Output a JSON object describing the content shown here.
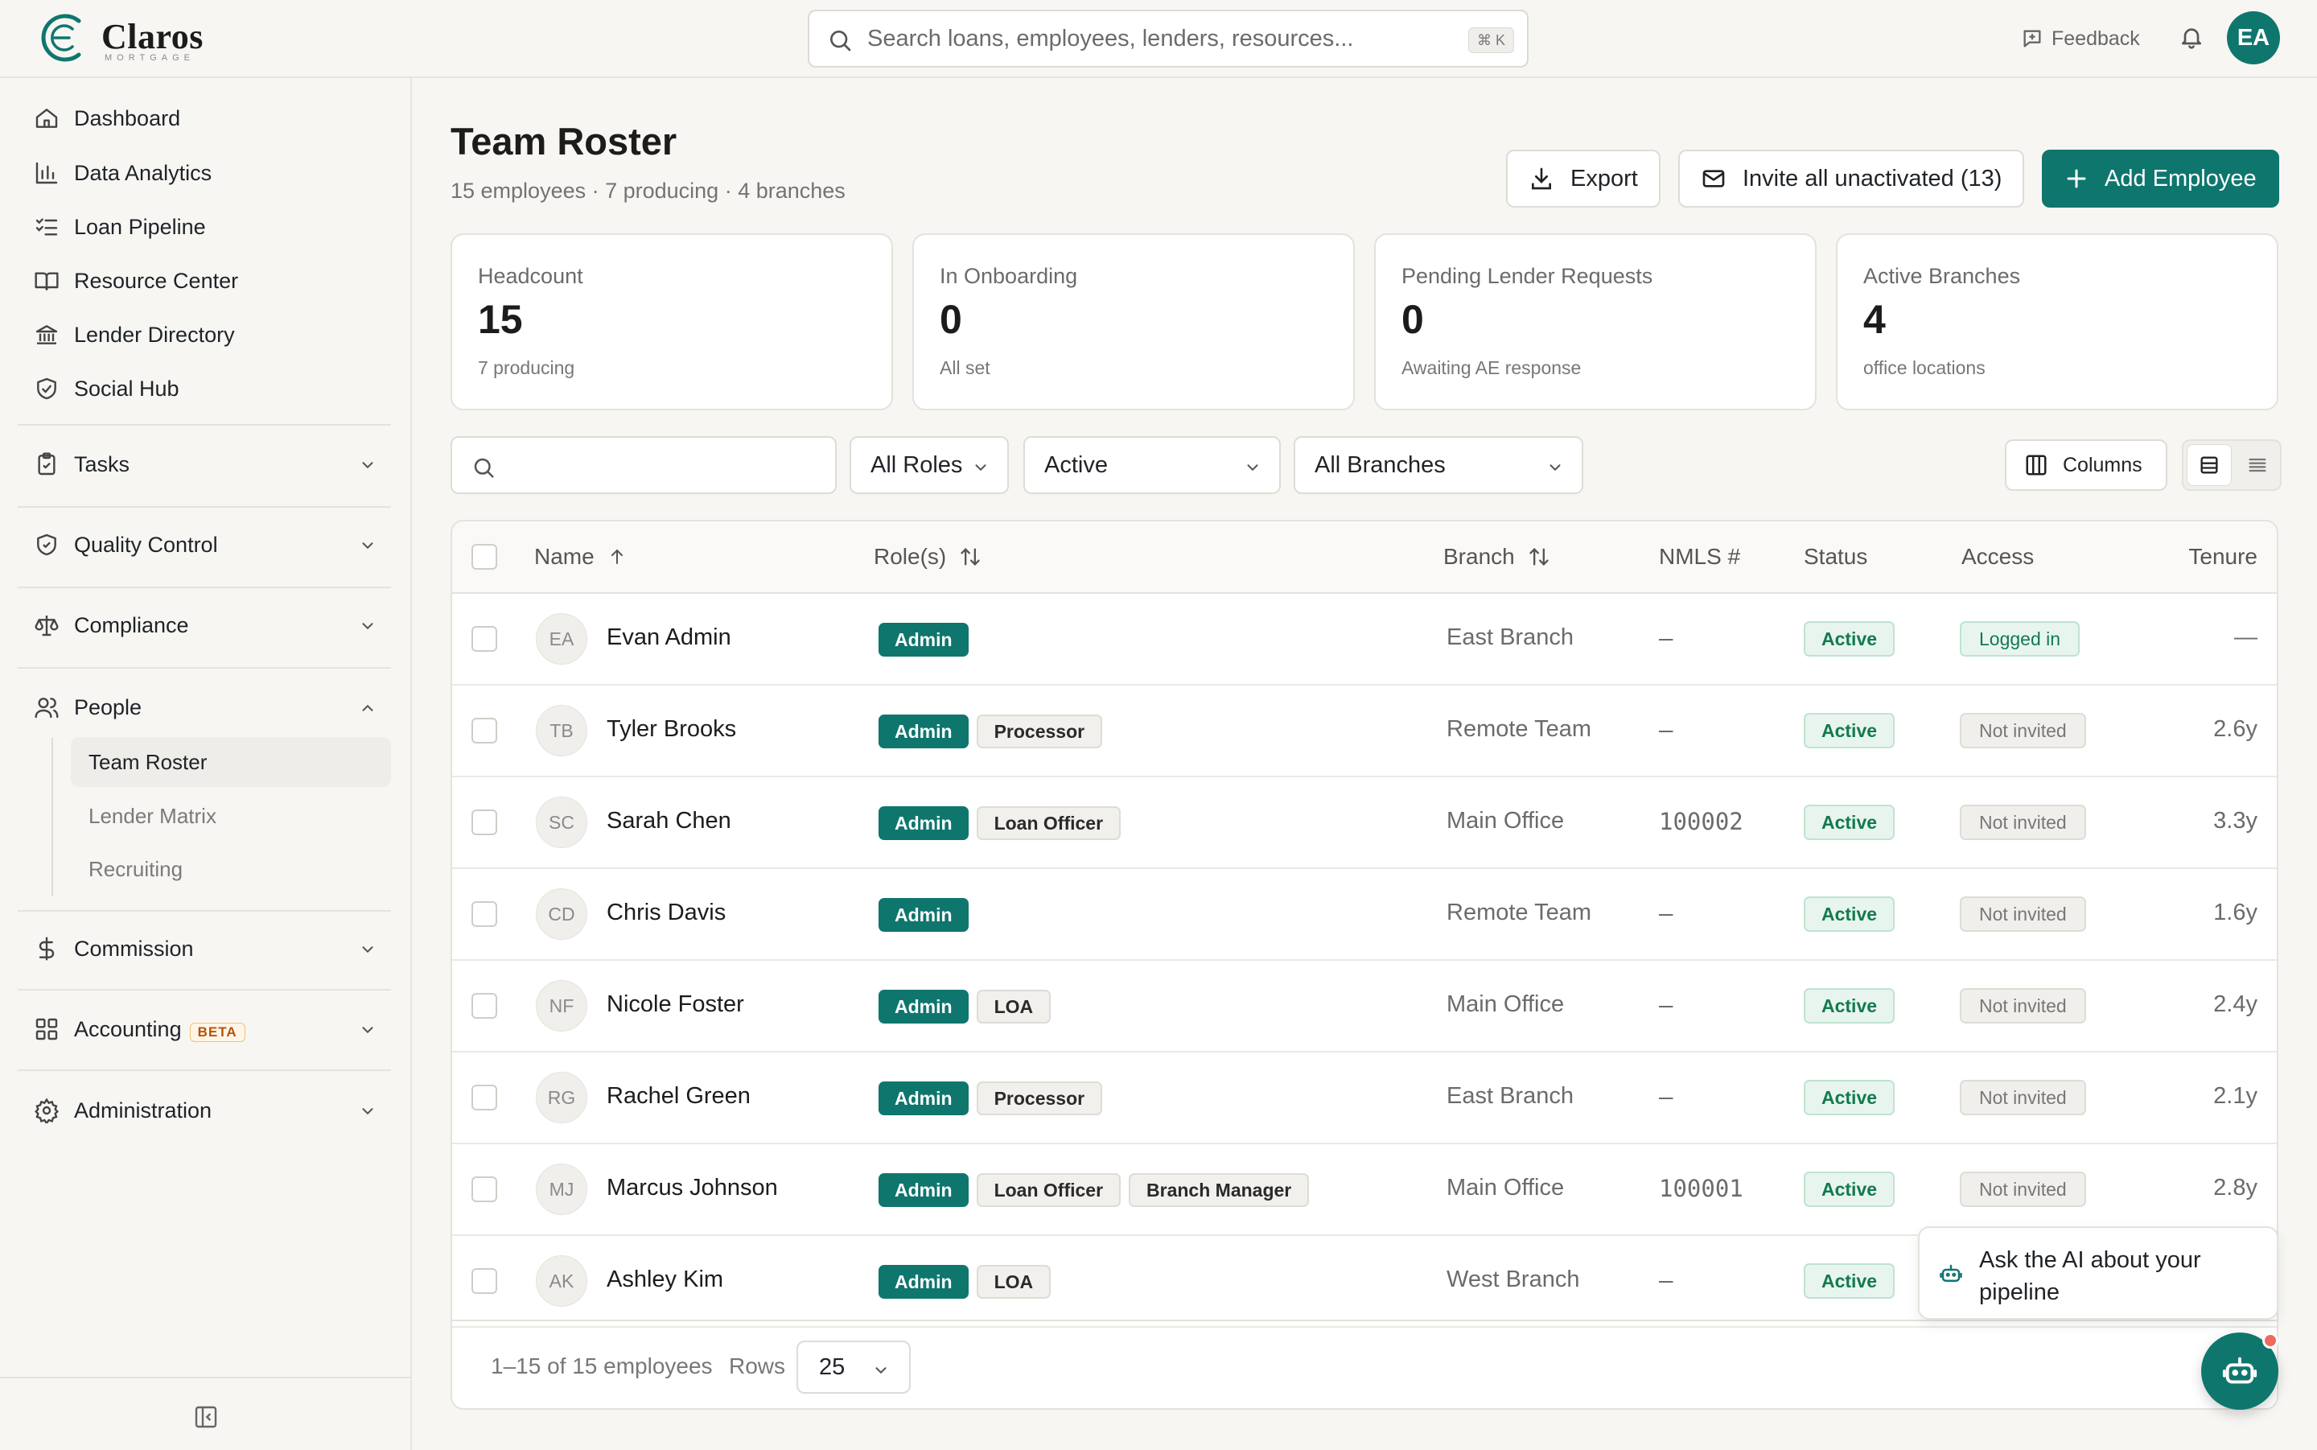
{
  "brand": {
    "name": "Claros",
    "sub": "MORTGAGE",
    "color": "#0f766e"
  },
  "search": {
    "placeholder": "Search loans, employees, lenders, resources...",
    "shortcut": "⌘ K"
  },
  "topbar": {
    "feedback": "Feedback",
    "avatar": "EA"
  },
  "sidebar": {
    "items": [
      {
        "label": "Dashboard",
        "icon": "home-icon"
      },
      {
        "label": "Data Analytics",
        "icon": "bar-chart-icon"
      },
      {
        "label": "Loan Pipeline",
        "icon": "list-check-icon"
      },
      {
        "label": "Resource Center",
        "icon": "book-icon"
      },
      {
        "label": "Lender Directory",
        "icon": "bank-icon"
      },
      {
        "label": "Social Hub",
        "icon": "badge-icon"
      }
    ],
    "groups": {
      "tasks": "Tasks",
      "quality": "Quality Control",
      "compliance": "Compliance",
      "people": "People",
      "commission": "Commission",
      "accounting": "Accounting",
      "accounting_badge": "BETA",
      "administration": "Administration"
    },
    "people_sub": [
      "Team Roster",
      "Lender Matrix",
      "Recruiting"
    ]
  },
  "page": {
    "title": "Team Roster",
    "subtitle": "15 employees · 7 producing · 4 branches",
    "buttons": {
      "export": "Export",
      "invite": "Invite all unactivated (13)",
      "add": "Add Employee"
    }
  },
  "stats": [
    {
      "label": "Headcount",
      "value": "15",
      "hint": "7 producing"
    },
    {
      "label": "In Onboarding",
      "value": "0",
      "hint": "All set"
    },
    {
      "label": "Pending Lender Requests",
      "value": "0",
      "hint": "Awaiting AE response"
    },
    {
      "label": "Active Branches",
      "value": "4",
      "hint": "office locations"
    }
  ],
  "filters": {
    "roles": "All Roles",
    "status": "Active",
    "branches": "All Branches",
    "columns": "Columns"
  },
  "table": {
    "headers": {
      "name": "Name",
      "roles": "Role(s)",
      "branch": "Branch",
      "nmls": "NMLS #",
      "status": "Status",
      "access": "Access",
      "tenure": "Tenure"
    },
    "rows": [
      {
        "initials": "EA",
        "name": "Evan Admin",
        "roles": [
          "Admin"
        ],
        "branch": "East Branch",
        "nmls": "–",
        "status": "Active",
        "access": "Logged in",
        "tenure": "—"
      },
      {
        "initials": "TB",
        "name": "Tyler Brooks",
        "roles": [
          "Admin",
          "Processor"
        ],
        "branch": "Remote Team",
        "nmls": "–",
        "status": "Active",
        "access": "Not invited",
        "tenure": "2.6y"
      },
      {
        "initials": "SC",
        "name": "Sarah Chen",
        "roles": [
          "Admin",
          "Loan Officer"
        ],
        "branch": "Main Office",
        "nmls": "100002",
        "status": "Active",
        "access": "Not invited",
        "tenure": "3.3y"
      },
      {
        "initials": "CD",
        "name": "Chris Davis",
        "roles": [
          "Admin"
        ],
        "branch": "Remote Team",
        "nmls": "–",
        "status": "Active",
        "access": "Not invited",
        "tenure": "1.6y"
      },
      {
        "initials": "NF",
        "name": "Nicole Foster",
        "roles": [
          "Admin",
          "LOA"
        ],
        "branch": "Main Office",
        "nmls": "–",
        "status": "Active",
        "access": "Not invited",
        "tenure": "2.4y"
      },
      {
        "initials": "RG",
        "name": "Rachel Green",
        "roles": [
          "Admin",
          "Processor"
        ],
        "branch": "East Branch",
        "nmls": "–",
        "status": "Active",
        "access": "Not invited",
        "tenure": "2.1y"
      },
      {
        "initials": "MJ",
        "name": "Marcus Johnson",
        "roles": [
          "Admin",
          "Loan Officer",
          "Branch Manager"
        ],
        "branch": "Main Office",
        "nmls": "100001",
        "status": "Active",
        "access": "Not invited",
        "tenure": "2.8y"
      },
      {
        "initials": "AK",
        "name": "Ashley Kim",
        "roles": [
          "Admin",
          "LOA"
        ],
        "branch": "West Branch",
        "nmls": "–",
        "status": "Active",
        "access": "",
        "tenure": ""
      }
    ],
    "footer": {
      "range": "1–15 of 15 employees",
      "rows_label": "Rows",
      "rows_value": "25"
    }
  },
  "ai": {
    "tip": "Ask the AI about your pipeline"
  }
}
